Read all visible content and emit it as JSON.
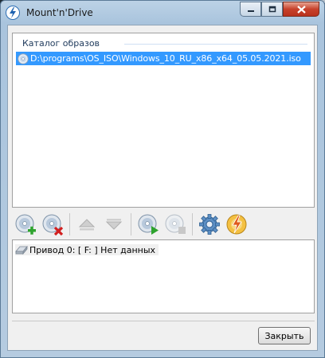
{
  "window": {
    "title": "Mount'n'Drive"
  },
  "catalog": {
    "header": "Каталог образов",
    "items": [
      {
        "path": "D:\\programs\\OS_ISO\\Windows_10_RU_x86_x64_05.05.2021.iso",
        "selected": true
      }
    ]
  },
  "toolbar": {
    "buttons": [
      {
        "name": "add-image-icon"
      },
      {
        "name": "remove-image-icon"
      },
      {
        "name": "move-up-icon"
      },
      {
        "name": "move-down-icon"
      },
      {
        "name": "mount-icon"
      },
      {
        "name": "unmount-icon"
      },
      {
        "name": "settings-icon"
      },
      {
        "name": "about-icon"
      }
    ]
  },
  "drives": {
    "items": [
      {
        "label": "Привод 0: [ F: ] Нет данных"
      }
    ]
  },
  "footer": {
    "close_label": "Закрыть"
  },
  "colors": {
    "selection": "#3399ff",
    "close_caption": "#c7412b"
  }
}
